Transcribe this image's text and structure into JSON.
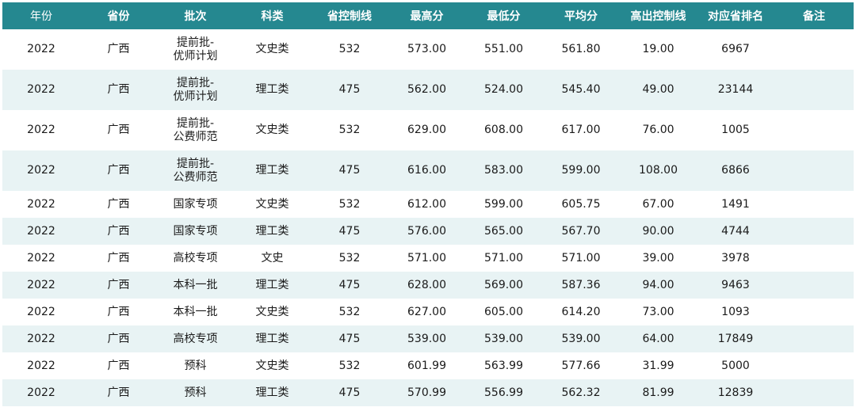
{
  "table": {
    "headers": [
      "年份",
      "省份",
      "批次",
      "科类",
      "省控制线",
      "最高分",
      "最低分",
      "平均分",
      "高出控制线",
      "对应省排名",
      "备注"
    ],
    "rows": [
      [
        "2022",
        "广西",
        "提前批-优师计划",
        "文史类",
        "532",
        "573.00",
        "551.00",
        "561.80",
        "19.00",
        "6967",
        ""
      ],
      [
        "2022",
        "广西",
        "提前批-优师计划",
        "理工类",
        "475",
        "562.00",
        "524.00",
        "545.40",
        "49.00",
        "23144",
        ""
      ],
      [
        "2022",
        "广西",
        "提前批-公费师范",
        "文史类",
        "532",
        "629.00",
        "608.00",
        "617.00",
        "76.00",
        "1005",
        ""
      ],
      [
        "2022",
        "广西",
        "提前批-公费师范",
        "理工类",
        "475",
        "616.00",
        "583.00",
        "599.00",
        "108.00",
        "6866",
        ""
      ],
      [
        "2022",
        "广西",
        "国家专项",
        "文史类",
        "532",
        "612.00",
        "599.00",
        "605.75",
        "67.00",
        "1491",
        ""
      ],
      [
        "2022",
        "广西",
        "国家专项",
        "理工类",
        "475",
        "576.00",
        "565.00",
        "567.70",
        "90.00",
        "4744",
        ""
      ],
      [
        "2022",
        "广西",
        "高校专项",
        "文史",
        "532",
        "571.00",
        "571.00",
        "571.00",
        "39.00",
        "3978",
        ""
      ],
      [
        "2022",
        "广西",
        "本科一批",
        "理工类",
        "475",
        "628.00",
        "569.00",
        "587.36",
        "94.00",
        "9463",
        ""
      ],
      [
        "2022",
        "广西",
        "本科一批",
        "文史类",
        "532",
        "627.00",
        "605.00",
        "614.20",
        "73.00",
        "1093",
        ""
      ],
      [
        "2022",
        "广西",
        "高校专项",
        "理工类",
        "475",
        "539.00",
        "539.00",
        "539.00",
        "64.00",
        "17849",
        ""
      ],
      [
        "2022",
        "广西",
        "预科",
        "文史类",
        "532",
        "601.99",
        "563.99",
        "577.66",
        "31.99",
        "5000",
        ""
      ],
      [
        "2022",
        "广西",
        "预科",
        "理工类",
        "475",
        "570.99",
        "556.99",
        "562.32",
        "81.99",
        "12839",
        ""
      ]
    ]
  }
}
